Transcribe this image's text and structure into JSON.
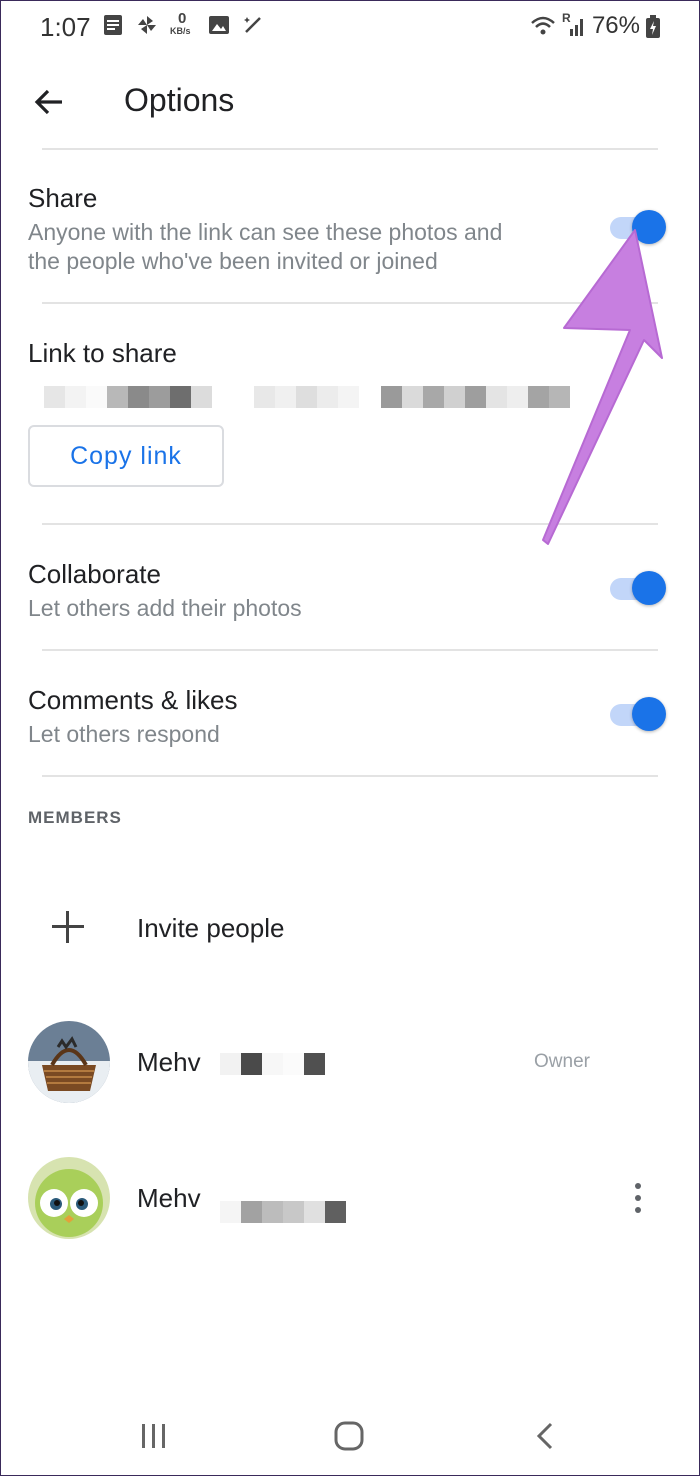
{
  "status": {
    "time": "1:07",
    "net_speed_value": "0",
    "net_speed_unit": "KB/s",
    "signal_label": "R",
    "battery": "76%"
  },
  "app_bar": {
    "title": "Options"
  },
  "share": {
    "title": "Share",
    "subtitle_line1": "Anyone with the link can see these photos and",
    "subtitle_line2": "the people who've been invited or joined",
    "enabled": true
  },
  "link": {
    "title": "Link to share",
    "copy_label": "Copy link"
  },
  "collaborate": {
    "title": "Collaborate",
    "subtitle": "Let others add their photos",
    "enabled": true
  },
  "comments": {
    "title": "Comments & likes",
    "subtitle": "Let others respond",
    "enabled": true
  },
  "members": {
    "section_label": "MEMBERS",
    "invite_label": "Invite people",
    "list": [
      {
        "name": "Mehv",
        "role": "Owner"
      },
      {
        "name": "Mehv",
        "role": ""
      }
    ]
  },
  "colors": {
    "accent": "#1a73e8",
    "toggle_track": "#c2d6f9",
    "annotation_arrow": "#c77fe0"
  },
  "icons": [
    "back-arrow-icon",
    "more-vert-icon",
    "plus-icon",
    "recents-icon",
    "home-icon",
    "back-nav-icon"
  ]
}
